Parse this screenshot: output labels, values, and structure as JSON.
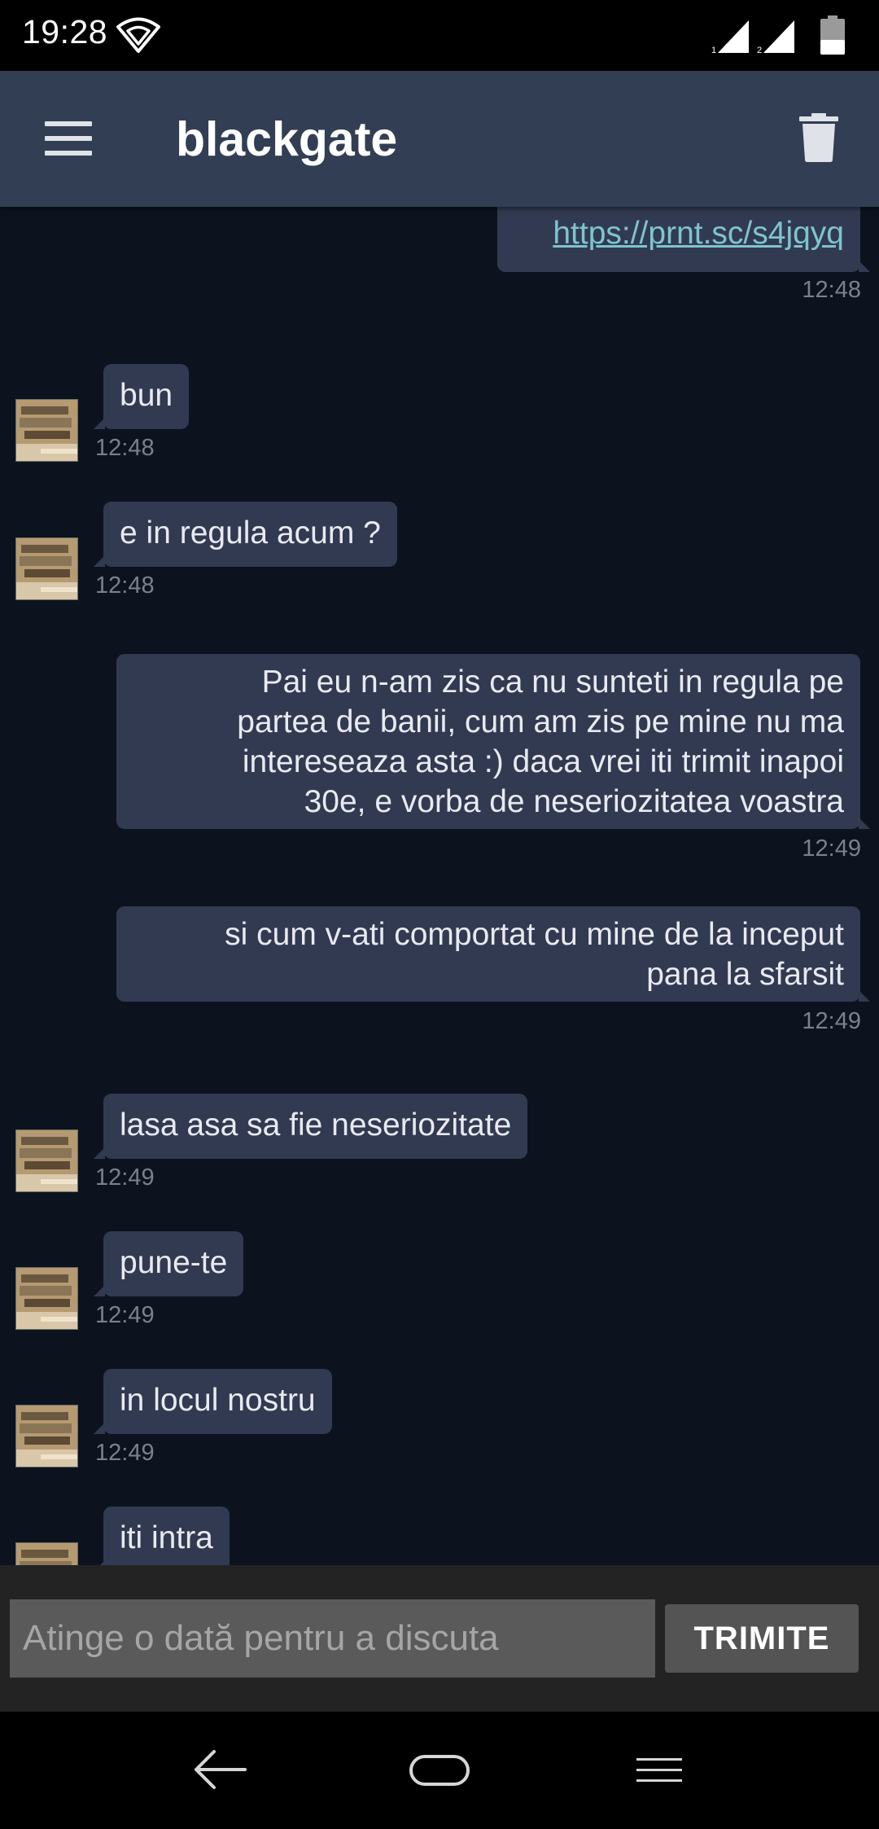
{
  "status_bar": {
    "time": "19:28",
    "sim1_label": "1",
    "sim2_label": "2"
  },
  "app_bar": {
    "menu_icon": "menu-icon",
    "title": "blackgate",
    "trash_icon": "trash-icon"
  },
  "messages": [
    {
      "direction": "out",
      "text": "https://prnt.sc/s4jqyq",
      "is_link": true,
      "time": "12:48"
    },
    {
      "direction": "in",
      "text": "bun",
      "time": "12:48"
    },
    {
      "direction": "in",
      "text": "e in regula acum ?",
      "time": "12:48"
    },
    {
      "direction": "out",
      "lines": [
        "Pai eu n-am zis ca nu sunteti in regula pe",
        "partea de banii, cum am zis pe mine nu ma",
        "intereseaza asta :) daca vrei iti trimit inapoi",
        "30e, e vorba de neseriozitatea voastra"
      ],
      "time": "12:49"
    },
    {
      "direction": "out",
      "lines": [
        "si cum v-ati comportat cu mine de la inceput",
        "pana la sfarsit"
      ],
      "time": "12:49"
    },
    {
      "direction": "in",
      "text": "lasa asa sa fie neseriozitate",
      "time": "12:49"
    },
    {
      "direction": "in",
      "text": "pune-te",
      "time": "12:49"
    },
    {
      "direction": "in",
      "text": "in locul nostru",
      "time": "12:49"
    },
    {
      "direction": "in",
      "text": "iti intra",
      "time": ""
    }
  ],
  "composer": {
    "placeholder": "Atinge o dată pentru a discuta",
    "value": "",
    "send_label": "TRIMITE"
  },
  "colors": {
    "app_bar": "#323e53",
    "chat_background": "#0c131e",
    "bubble": "#323a52",
    "link": "#7ec4ce",
    "timestamp": "#7a818c"
  }
}
